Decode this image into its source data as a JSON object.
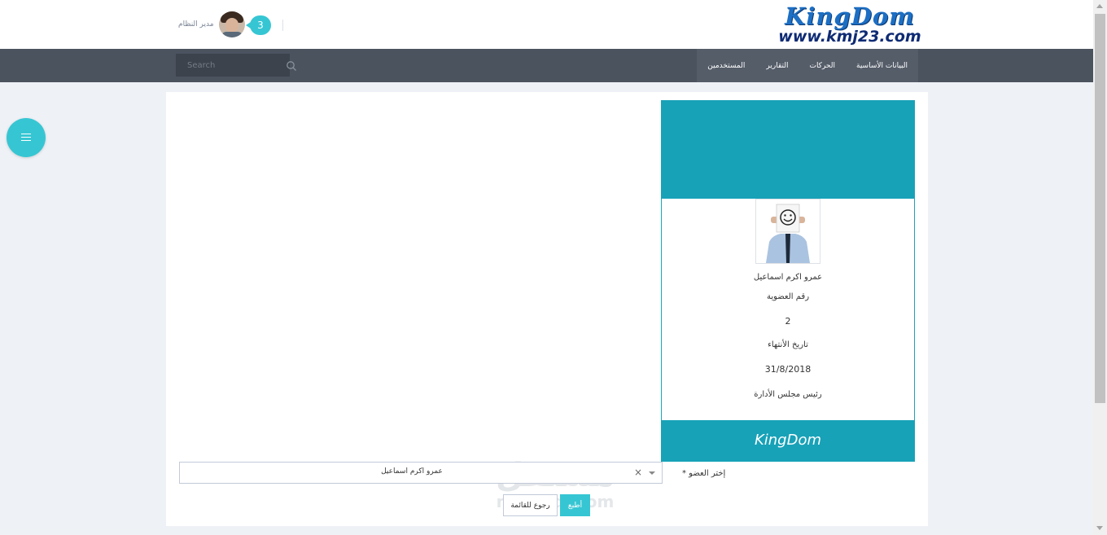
{
  "header": {
    "user_name": "مدير النظام",
    "notification_count": "3",
    "logo_title": "KingDom",
    "logo_url": "www.kmj23.com"
  },
  "nav": {
    "search_placeholder": "Search",
    "items": [
      {
        "label": "البيانات الأساسية"
      },
      {
        "label": "الحركات"
      },
      {
        "label": "التقارير"
      },
      {
        "label": "المستخدمين"
      }
    ]
  },
  "card": {
    "member_name": "عمرو اكرم اسماعيل",
    "membership_label": "رقم العضوية",
    "membership_number": "2",
    "expiry_label": "تاريخ الأنتهاء",
    "expiry_date": "31/8/2018",
    "position": "رئيس مجلس الأدارة",
    "footer_brand": "KingDom"
  },
  "form": {
    "member_label": "إختر العضو *",
    "member_selected": "عمرو اكرم اسماعيل",
    "clear_symbol": "×",
    "back_button": "رجوع للقائمة",
    "print_button": "أطبع"
  },
  "watermark": {
    "arabic": "مستقل",
    "english": "mostaql.com"
  },
  "colors": {
    "accent": "#36c6d3",
    "card_header": "#17a2b8",
    "navbar": "#4b535f",
    "logo_blue": "#1c6fc4"
  },
  "icons": {
    "search": "search-icon",
    "menu_toggle": "hamburger-icon",
    "clear": "close-icon",
    "dropdown": "chevron-down-icon"
  }
}
